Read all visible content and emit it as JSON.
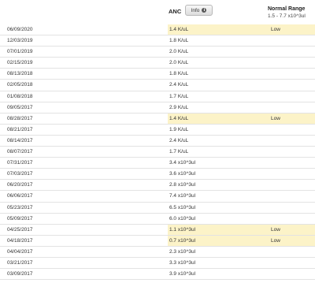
{
  "header": {
    "test_name": "ANC",
    "info_button": "Info",
    "normal_range_label": "Normal Range",
    "normal_range_value": "1.5 - 7.7 x10^3ul"
  },
  "rows": [
    {
      "date": "06/09/2020",
      "value": "1.4 K/uL",
      "flag": "Low"
    },
    {
      "date": "12/03/2019",
      "value": "1.8 K/uL",
      "flag": ""
    },
    {
      "date": "07/01/2019",
      "value": "2.0 K/uL",
      "flag": ""
    },
    {
      "date": "02/15/2019",
      "value": "2.0 K/uL",
      "flag": ""
    },
    {
      "date": "08/13/2018",
      "value": "1.8 K/uL",
      "flag": ""
    },
    {
      "date": "02/05/2018",
      "value": "2.4 K/uL",
      "flag": ""
    },
    {
      "date": "01/08/2018",
      "value": "1.7 K/uL",
      "flag": ""
    },
    {
      "date": "09/05/2017",
      "value": "2.9 K/uL",
      "flag": ""
    },
    {
      "date": "08/28/2017",
      "value": "1.4 K/uL",
      "flag": "Low"
    },
    {
      "date": "08/21/2017",
      "value": "1.9 K/uL",
      "flag": ""
    },
    {
      "date": "08/14/2017",
      "value": "2.4 K/uL",
      "flag": ""
    },
    {
      "date": "08/07/2017",
      "value": "1.7 K/uL",
      "flag": ""
    },
    {
      "date": "07/31/2017",
      "value": "3.4 x10^3ul",
      "flag": ""
    },
    {
      "date": "07/03/2017",
      "value": "3.6 x10^3ul",
      "flag": ""
    },
    {
      "date": "06/20/2017",
      "value": "2.8 x10^3ul",
      "flag": ""
    },
    {
      "date": "06/06/2017",
      "value": "7.4 x10^3ul",
      "flag": ""
    },
    {
      "date": "05/23/2017",
      "value": "6.5 x10^3ul",
      "flag": ""
    },
    {
      "date": "05/09/2017",
      "value": "6.0 x10^3ul",
      "flag": ""
    },
    {
      "date": "04/25/2017",
      "value": "1.1 x10^3ul",
      "flag": "Low"
    },
    {
      "date": "04/18/2017",
      "value": "0.7 x10^3ul",
      "flag": "Low"
    },
    {
      "date": "04/04/2017",
      "value": "2.3 x10^3ul",
      "flag": ""
    },
    {
      "date": "03/21/2017",
      "value": "3.3 x10^3ul",
      "flag": ""
    },
    {
      "date": "03/09/2017",
      "value": "3.9 x10^3ul",
      "flag": ""
    }
  ]
}
